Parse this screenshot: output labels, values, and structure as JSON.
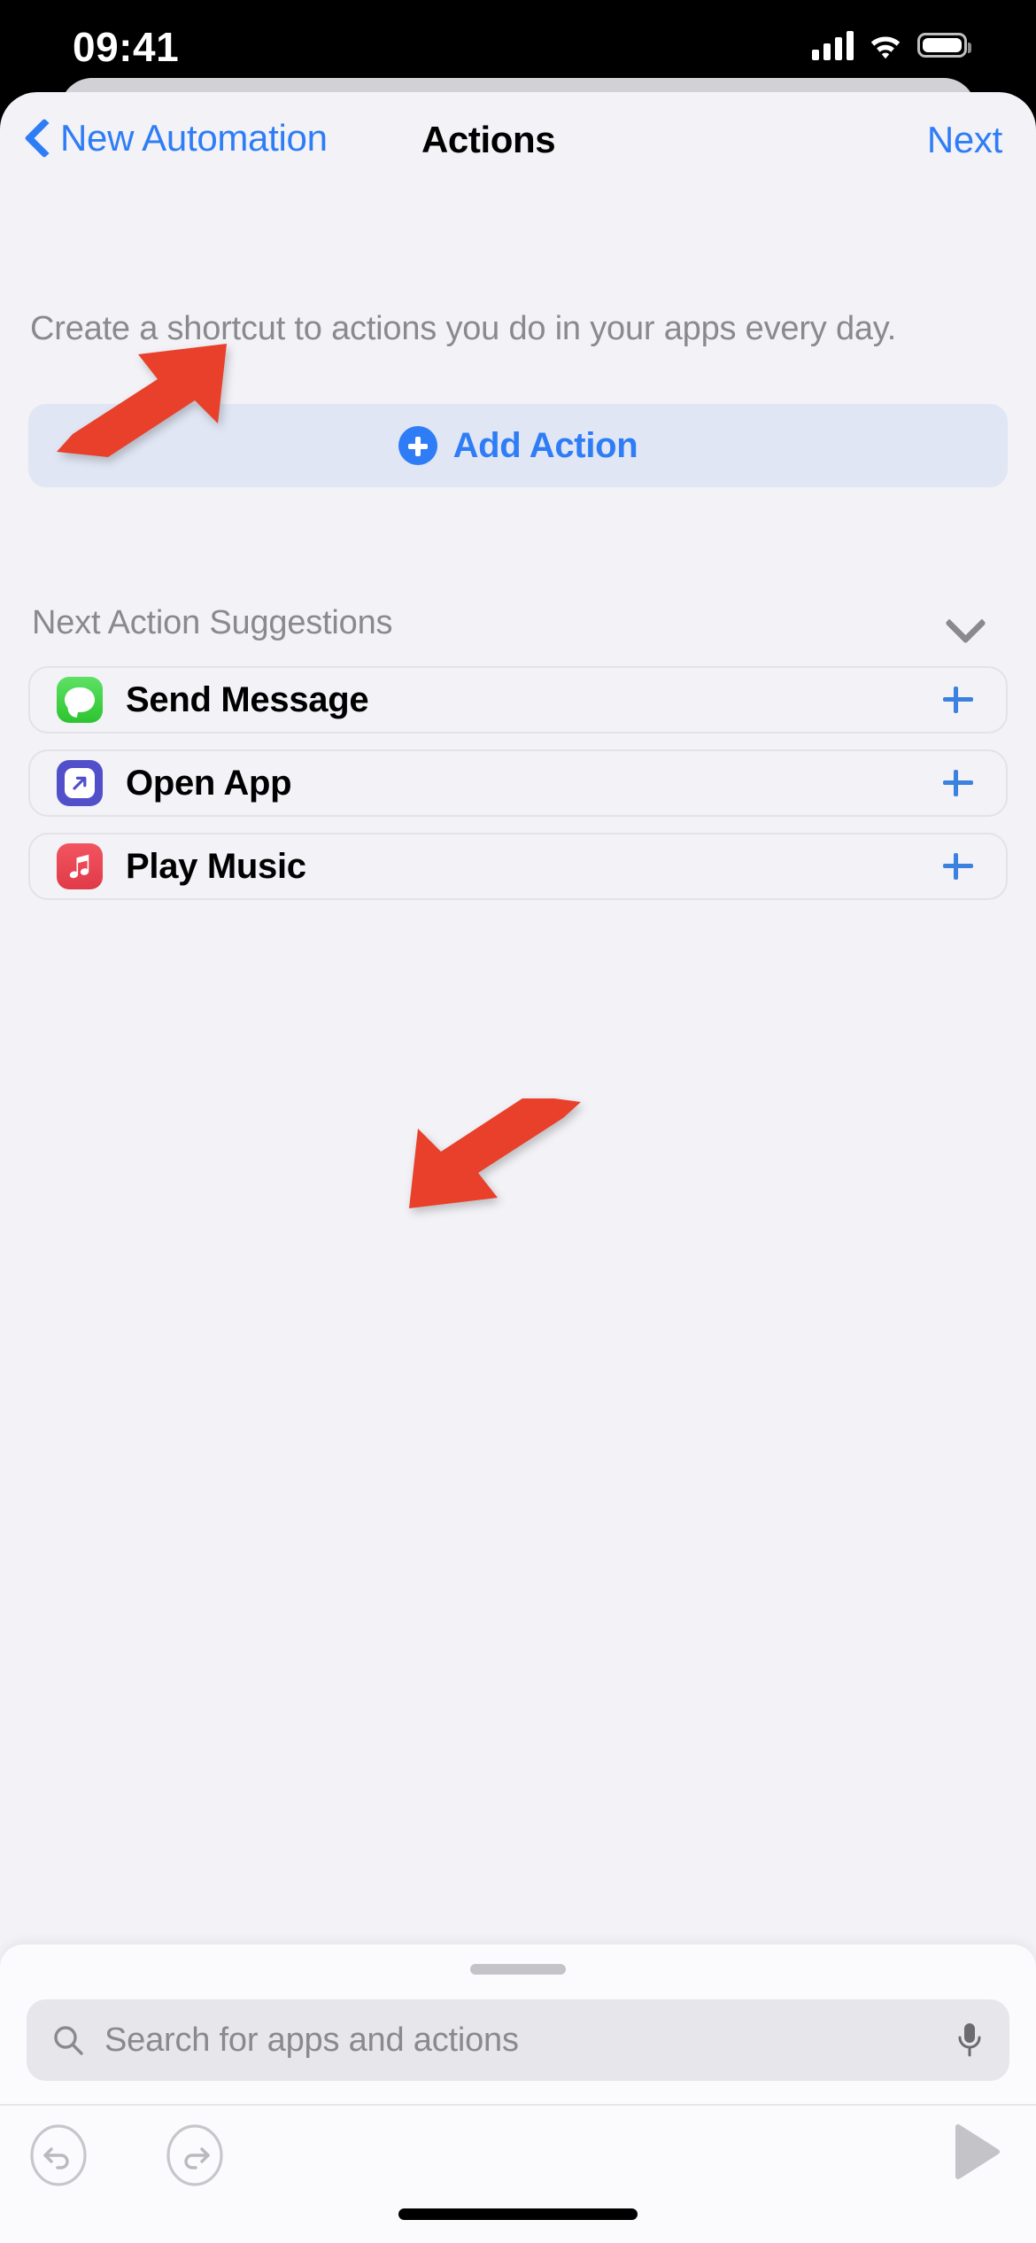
{
  "status_bar": {
    "time": "09:41",
    "cellular_icon": "cellular-bars-icon",
    "wifi_icon": "wifi-icon",
    "battery_icon": "battery-full-icon"
  },
  "nav": {
    "back_label": "New Automation",
    "back_icon": "chevron-left-icon",
    "title": "Actions",
    "next_label": "Next"
  },
  "main": {
    "description": "Create a shortcut to actions you do in your apps every day.",
    "add_action_label": "Add Action",
    "add_action_icon": "plus-circle-icon",
    "suggestions_header": "Next Action Suggestions",
    "suggestions_collapse_icon": "chevron-down-icon",
    "suggestions": [
      {
        "label": "Send Message",
        "icon": "messages-app-icon",
        "add_icon": "plus-icon"
      },
      {
        "label": "Open App",
        "icon": "open-app-icon",
        "add_icon": "plus-icon"
      },
      {
        "label": "Play Music",
        "icon": "music-app-icon",
        "add_icon": "plus-icon"
      }
    ]
  },
  "search_sheet": {
    "grabber_icon": "sheet-grabber-icon",
    "search_icon": "search-icon",
    "placeholder": "Search for apps and actions",
    "mic_icon": "microphone-icon"
  },
  "toolbar": {
    "undo_icon": "undo-icon",
    "redo_icon": "redo-icon",
    "play_icon": "play-icon"
  },
  "annotations": {
    "arrow_color": "#e8402a",
    "arrow_1_target": "add-action-button",
    "arrow_2_target": "search-input"
  },
  "colors": {
    "accent_blue": "#2f7df6",
    "sheet_bg": "#f2f2f7",
    "add_action_bg": "#e0e6f4",
    "secondary_text": "#8a8a8e"
  }
}
